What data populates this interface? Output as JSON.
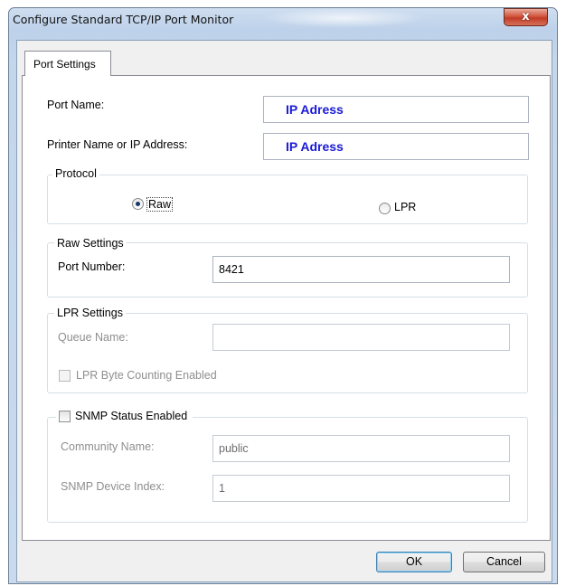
{
  "window": {
    "title": "Configure Standard TCP/IP Port Monitor",
    "close_glyph": "x"
  },
  "tabs": [
    {
      "label": "Port Settings",
      "selected": true
    }
  ],
  "port": {
    "name_label": "Port Name:",
    "name_value": "IP Adress",
    "address_label": "Printer Name or IP Address:",
    "address_value": "IP Adress"
  },
  "protocol": {
    "legend": "Protocol",
    "options": [
      {
        "label": "Raw",
        "selected": true
      },
      {
        "label": "LPR",
        "selected": false
      }
    ]
  },
  "raw_settings": {
    "legend": "Raw Settings",
    "port_number_label": "Port Number:",
    "port_number_value": "8421"
  },
  "lpr_settings": {
    "legend": "LPR Settings",
    "queue_name_label": "Queue Name:",
    "queue_name_value": "",
    "byte_counting_label": "LPR Byte Counting Enabled",
    "byte_counting_checked": false
  },
  "snmp": {
    "status_label": "SNMP Status Enabled",
    "status_checked": false,
    "community_label": "Community Name:",
    "community_value": "public",
    "device_index_label": "SNMP Device Index:",
    "device_index_value": "1"
  },
  "buttons": {
    "ok": "OK",
    "cancel": "Cancel"
  },
  "colors": {
    "value_text": "#1a1ad6",
    "close_button": "#c03c26",
    "title_bar": "#bdd1ea"
  }
}
